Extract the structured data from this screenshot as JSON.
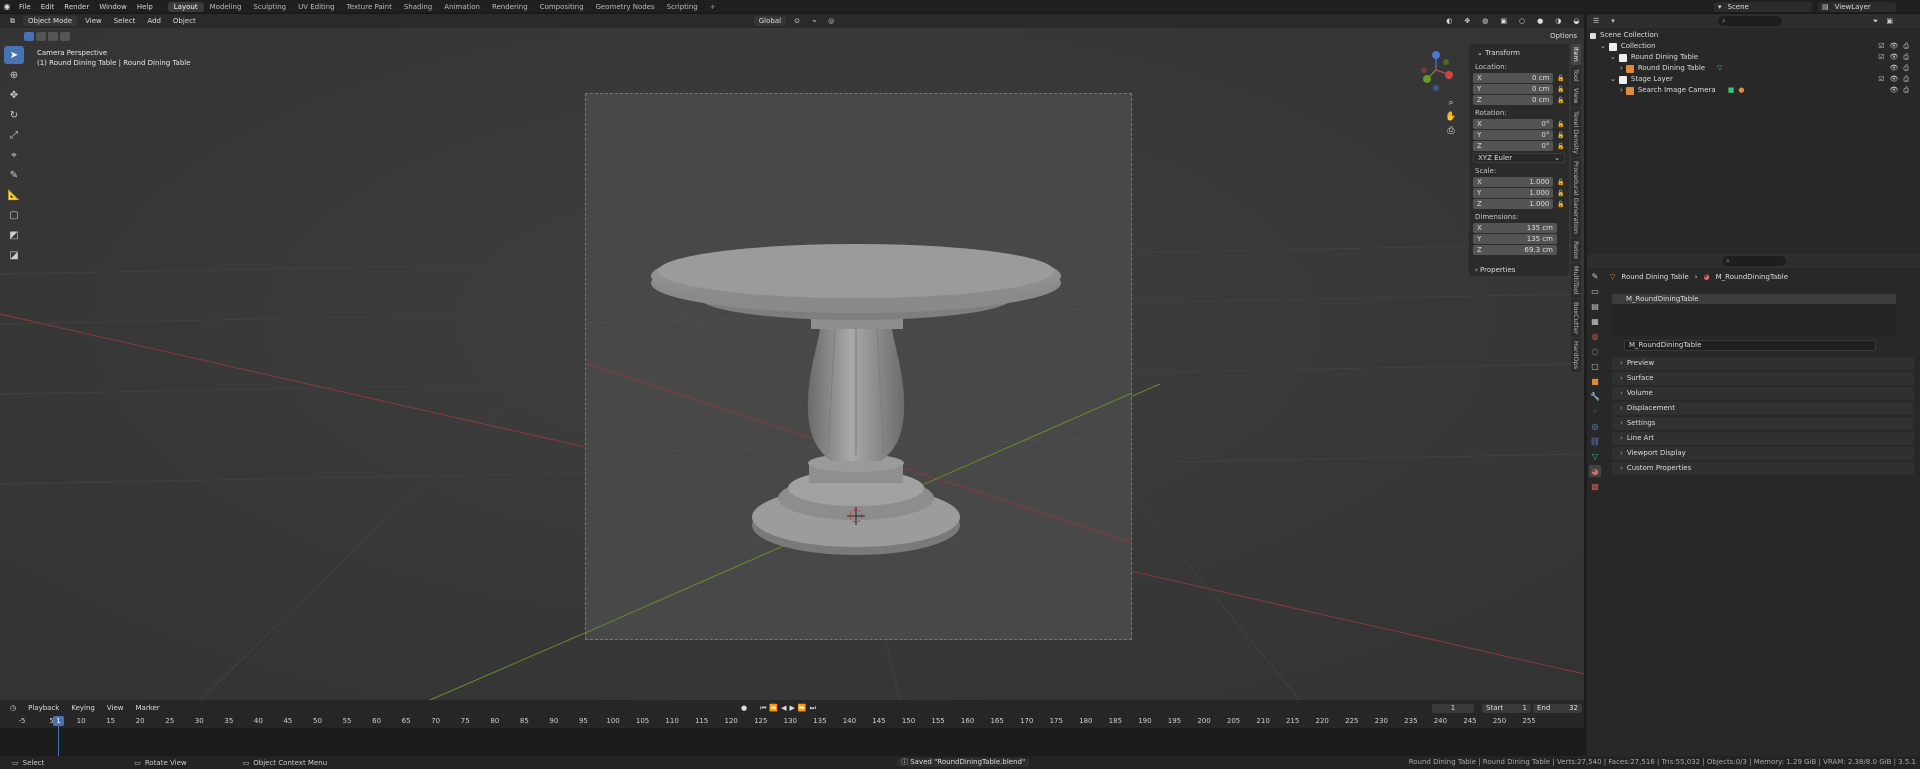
{
  "topbar": {
    "menus": [
      "File",
      "Edit",
      "Render",
      "Window",
      "Help"
    ],
    "workspaces": [
      "Layout",
      "Modeling",
      "Sculpting",
      "UV Editing",
      "Texture Paint",
      "Shading",
      "Animation",
      "Rendering",
      "Compositing",
      "Geometry Nodes",
      "Scripting"
    ],
    "active_workspace": "Layout",
    "scene": "Scene",
    "view_layer": "ViewLayer"
  },
  "viewport": {
    "mode": "Object Mode",
    "menus": [
      "View",
      "Select",
      "Add",
      "Object"
    ],
    "orientation": "Global",
    "options": "Options",
    "camera_title": "Camera Perspective",
    "camera_subtitle": "(1) Round Dining Table | Round Dining Table"
  },
  "npanel": {
    "transform_header": "Transform",
    "location_label": "Location:",
    "location": [
      {
        "axis": "X",
        "value": "0 cm"
      },
      {
        "axis": "Y",
        "value": "0 cm"
      },
      {
        "axis": "Z",
        "value": "0 cm"
      }
    ],
    "rotation_label": "Rotation:",
    "rotation": [
      {
        "axis": "X",
        "value": "0°"
      },
      {
        "axis": "Y",
        "value": "0°"
      },
      {
        "axis": "Z",
        "value": "0°"
      }
    ],
    "rotation_mode": "XYZ Euler",
    "scale_label": "Scale:",
    "scale": [
      {
        "axis": "X",
        "value": "1.000"
      },
      {
        "axis": "Y",
        "value": "1.000"
      },
      {
        "axis": "Z",
        "value": "1.000"
      }
    ],
    "dimensions_label": "Dimensions:",
    "dimensions": [
      {
        "axis": "X",
        "value": "135 cm"
      },
      {
        "axis": "Y",
        "value": "135 cm"
      },
      {
        "axis": "Z",
        "value": "69.3 cm"
      }
    ],
    "properties_header": "Properties",
    "tabs": [
      "Item",
      "Tool",
      "View",
      "Texel Density",
      "Procedural Generation",
      "Retox",
      "MultiTool",
      "BoxCutter",
      "HardOps"
    ]
  },
  "timeline": {
    "menus": [
      "Playback",
      "Keying",
      "View",
      "Marker"
    ],
    "current_frame": "1",
    "start_label": "Start",
    "start": "1",
    "end_label": "End",
    "end": "32",
    "ticks": [
      "-5",
      "1",
      "5",
      "10",
      "15",
      "20",
      "25",
      "30",
      "35",
      "40",
      "45",
      "50",
      "55",
      "60",
      "65",
      "70",
      "75",
      "80",
      "85",
      "90",
      "95",
      "100",
      "105",
      "110",
      "115",
      "120",
      "125",
      "130",
      "135",
      "140",
      "145",
      "150",
      "155",
      "160",
      "165",
      "170",
      "175",
      "180",
      "185",
      "190",
      "195",
      "200",
      "205",
      "210",
      "215",
      "220",
      "225",
      "230",
      "235",
      "240",
      "245",
      "250",
      "255"
    ]
  },
  "statusbar": {
    "select": "Select",
    "rotate": "Rotate View",
    "context": "Object Context Menu",
    "saved": "Saved \"RoundDiningTable.blend\"",
    "stats": "Round Dining Table | Round Dining Table | Verts:27,540 | Faces:27,516 | Tris:55,032 | Objects:0/3 | Memory: 1.29 GiB | VRAM: 2.38/8.0 GiB | 3.5.1"
  },
  "outliner": {
    "scene_collection": "Scene Collection",
    "collection": "Collection",
    "round_dining_table_coll": "Round Dining Table",
    "round_dining_table_obj": "Round Dining Table",
    "stage_layer": "Stage Layer",
    "camera": "Search Image Camera"
  },
  "properties": {
    "breadcrumb_object": "Round Dining Table",
    "breadcrumb_material": "M_RoundDiningTable",
    "material_slot": "M_RoundDiningTable",
    "material_name": "M_RoundDiningTable",
    "panels": [
      "Preview",
      "Surface",
      "Volume",
      "Displacement",
      "Settings",
      "Line Art",
      "Viewport Display",
      "Custom Properties"
    ]
  }
}
